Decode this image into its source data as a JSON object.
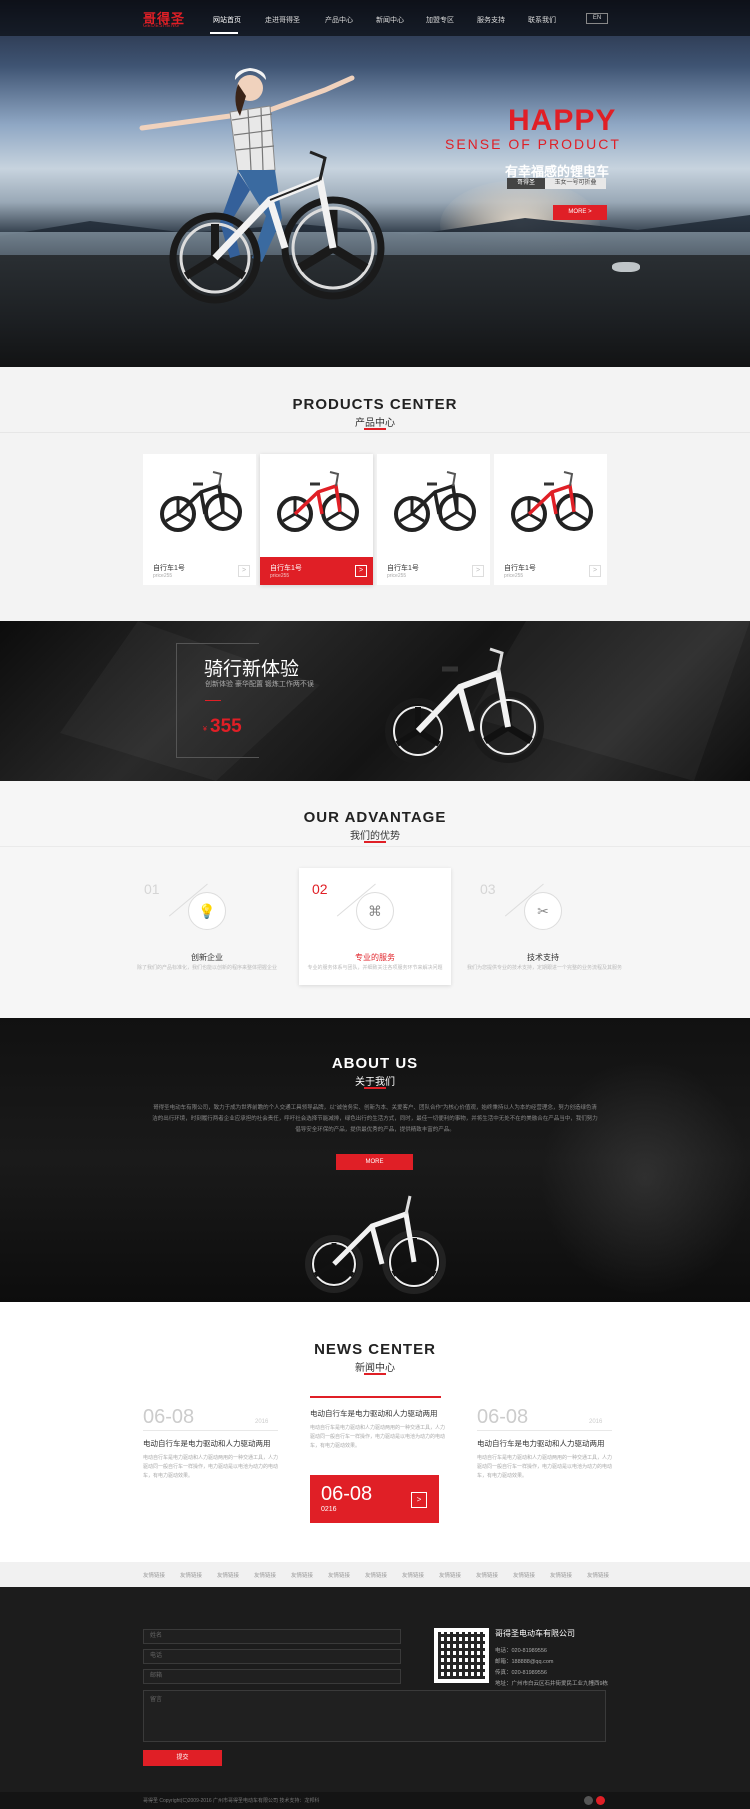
{
  "header": {
    "logo_text": "哥得圣",
    "logo_sub": "GEDESHENG",
    "nav": [
      {
        "label": "网站首页",
        "active": true
      },
      {
        "label": "走进哥得圣",
        "active": false
      },
      {
        "label": "产品中心",
        "active": false
      },
      {
        "label": "新闻中心",
        "active": false
      },
      {
        "label": "加盟专区",
        "active": false
      },
      {
        "label": "服务支持",
        "active": false
      },
      {
        "label": "联系我们",
        "active": false
      }
    ],
    "lang_button": "EN"
  },
  "hero": {
    "headline": "HAPPY",
    "subheadline": "SENSE  OF  PRODUCT",
    "tagline": "有幸福感的锂电车",
    "tag_brand": "哥得圣",
    "tag_model": "玉女一号可折叠",
    "more_button": "MORE  >"
  },
  "products": {
    "title": "PRODUCTS  CENTER",
    "subtitle": "产品中心",
    "items": [
      {
        "name": "自行车1号",
        "sub": "price255",
        "arrow": ">",
        "active": false,
        "frame_color": "#222222"
      },
      {
        "name": "自行车1号",
        "sub": "price255",
        "arrow": ">",
        "active": true,
        "frame_color": "#e01f26"
      },
      {
        "name": "自行车1号",
        "sub": "price255",
        "arrow": ">",
        "active": false,
        "frame_color": "#222222"
      },
      {
        "name": "自行车1号",
        "sub": "price255",
        "arrow": ">",
        "active": false,
        "frame_color": "#e01f26"
      }
    ]
  },
  "ride": {
    "title": "骑行新体验",
    "subtitle": "创新体验 豪华配置 锻炼工作两不误",
    "currency": "¥",
    "price": "355"
  },
  "advantage": {
    "title": "OUR ADVANTAGE",
    "subtitle": "我们的优势",
    "items": [
      {
        "num": "01",
        "name": "创新企业",
        "desc": "除了我们的产品标准化，我们也能以创新的程序来整体把握企业",
        "icon": "lightbulb-icon",
        "glyph": "💡",
        "active": false
      },
      {
        "num": "02",
        "name": "专业的服务",
        "desc": "专业的服务体系与团队，并细致关注各项服务环节来解决问题",
        "icon": "grid-icon",
        "glyph": "⌘",
        "active": true
      },
      {
        "num": "03",
        "name": "技术支持",
        "desc": "我们为您提供专业的技术支持，定期跟进一个完整的业务流程及其服务",
        "icon": "tools-icon",
        "glyph": "✂",
        "active": false
      }
    ]
  },
  "about": {
    "title": "ABOUT US",
    "subtitle": "关于我们",
    "text": "哥得圣电动车有限公司，致力于成为世界前瞻的个人交通工具领导品牌，以“诚信务实、创新为本、关爱客户、团队合作”为核心价值观，始终秉持以人为本的经营理念，努力创造绿色清洁的出行环境，时刻履行两者企业应承担的社会责任，呼吁社会选择节能减排，绿色出行的生活方式，同时，最佳一切便利的事物，并将生活中无处不在的美融合在产品当中，我们努力倡导安全环保的产品，提供最优秀的产品，提供精致丰富的产品。",
    "more_button": "MORE"
  },
  "news": {
    "title": "NEWS  CENTER",
    "subtitle": "新闻中心",
    "items": [
      {
        "date": "06-08",
        "year": "2016",
        "title": "电动自行车是电力驱动和人力驱动两用",
        "text": "电动自行车是电力驱动和人力驱动两用的一种交通工具，人力驱动同一般自行车一样操作，电力驱动是以电池为动力的电动车，有电力驱动效果。"
      },
      {
        "date": "",
        "year": "",
        "title": "电动自行车是电力驱动和人力驱动两用",
        "text": "电动自行车是电力驱动和人力驱动两用的一种交通工具，人力驱动同一般自行车一样操作，电力驱动是以电池为动力的电动车，有电力驱动效果。",
        "highlight_date": "06-08",
        "highlight_year": "0216",
        "arrow": ">"
      },
      {
        "date": "06-08",
        "year": "2016",
        "title": "电动自行车是电力驱动和人力驱动两用",
        "text": "电动自行车是电力驱动和人力驱动两用的一种交通工具，人力驱动同一般自行车一样操作，电力驱动是以电池为动力的电动车，有电力驱动效果。"
      }
    ]
  },
  "links": [
    "友情链接",
    "友情链接",
    "友情链接",
    "友情链接",
    "友情链接",
    "友情链接",
    "友情链接",
    "友情链接",
    "友情链接",
    "友情链接",
    "友情链接",
    "友情链接",
    "友情链接"
  ],
  "footer": {
    "name_placeholder": "姓名",
    "phone_placeholder": "电话",
    "email_placeholder": "邮箱",
    "message_placeholder": "留言",
    "submit": "提交",
    "company": "哥得圣电动车有限公司",
    "phone": "电话：020-81989556",
    "email": "邮箱：188888@qq.com",
    "fax": "传真：020-81989556",
    "address": "地址：广州市白云区石井街爱民工业九幢西9栋",
    "copyright": "哥得圣 Copyright(C)2009-2016 广州市哥得圣电动车有限公司    技术支持：龙邦科"
  },
  "colors": {
    "accent": "#e01f26",
    "dark": "#1c1c1c"
  }
}
